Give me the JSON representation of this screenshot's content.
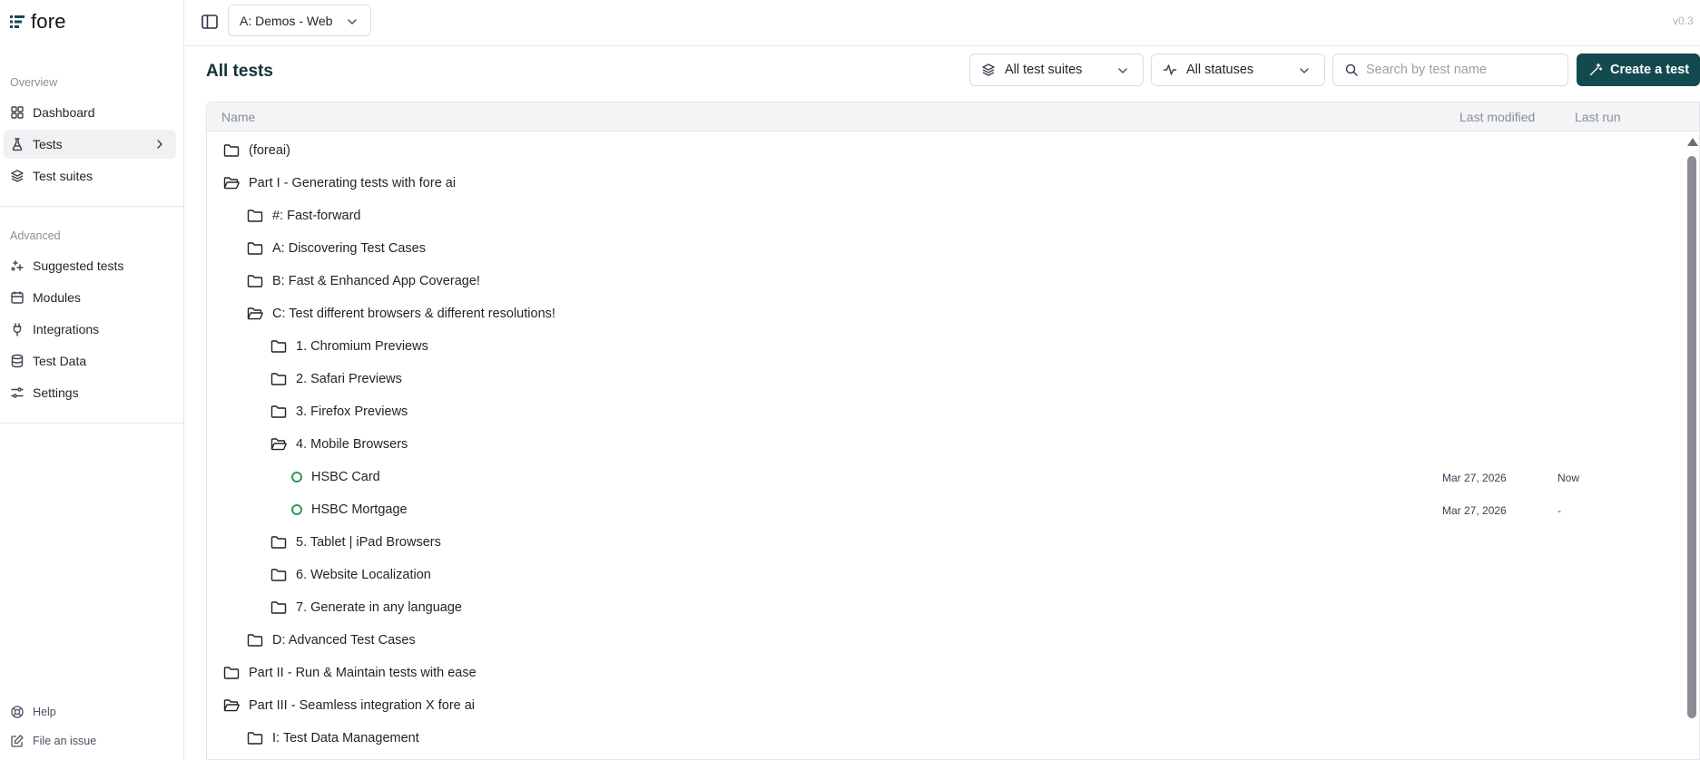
{
  "app": {
    "name": "fore",
    "version": "v0.3"
  },
  "topbar": {
    "project": "A: Demos - Web"
  },
  "sidebar": {
    "overview_label": "Overview",
    "overview_items": [
      {
        "label": "Dashboard",
        "icon": "dashboard-icon"
      },
      {
        "label": "Tests",
        "icon": "flask-icon",
        "active": true
      },
      {
        "label": "Test suites",
        "icon": "layers-icon"
      }
    ],
    "advanced_label": "Advanced",
    "advanced_items": [
      {
        "label": "Suggested tests",
        "icon": "sparkle-icon"
      },
      {
        "label": "Modules",
        "icon": "calendar-icon"
      },
      {
        "label": "Integrations",
        "icon": "plug-icon"
      },
      {
        "label": "Test Data",
        "icon": "database-icon"
      },
      {
        "label": "Settings",
        "icon": "sliders-icon"
      }
    ],
    "footer_items": [
      {
        "label": "Help",
        "icon": "help-icon"
      },
      {
        "label": "File an issue",
        "icon": "edit-icon"
      }
    ]
  },
  "main": {
    "title": "All tests",
    "filters": {
      "suites": "All test suites",
      "statuses": "All statuses"
    },
    "search_placeholder": "Search by test name",
    "create_label": "Create a test",
    "columns": {
      "name": "Name",
      "last_modified": "Last modified",
      "last_run": "Last run"
    },
    "rows": [
      {
        "name": "(foreai)",
        "depth": 0,
        "type": "folder",
        "open": false
      },
      {
        "name": "Part I - Generating tests with fore ai",
        "depth": 0,
        "type": "folder",
        "open": true
      },
      {
        "name": "#: Fast-forward",
        "depth": 1,
        "type": "folder",
        "open": false
      },
      {
        "name": "A: Discovering Test Cases",
        "depth": 1,
        "type": "folder",
        "open": false
      },
      {
        "name": "B: Fast & Enhanced App Coverage!",
        "depth": 1,
        "type": "folder",
        "open": false
      },
      {
        "name": "C: Test different browsers & different resolutions!",
        "depth": 1,
        "type": "folder",
        "open": true
      },
      {
        "name": "1. Chromium Previews",
        "depth": 2,
        "type": "folder",
        "open": false
      },
      {
        "name": "2. Safari Previews",
        "depth": 2,
        "type": "folder",
        "open": false
      },
      {
        "name": "3. Firefox Previews",
        "depth": 2,
        "type": "folder",
        "open": false
      },
      {
        "name": "4. Mobile Browsers",
        "depth": 2,
        "type": "folder",
        "open": true
      },
      {
        "name": "HSBC Card",
        "depth": 3,
        "type": "test",
        "last_modified": "Mar 27, 2026",
        "last_run": "Now"
      },
      {
        "name": "HSBC Mortgage",
        "depth": 3,
        "type": "test",
        "last_modified": "Mar 27, 2026",
        "last_run": "-"
      },
      {
        "name": "5. Tablet | iPad Browsers",
        "depth": 2,
        "type": "folder",
        "open": false
      },
      {
        "name": "6. Website Localization",
        "depth": 2,
        "type": "folder",
        "open": false
      },
      {
        "name": "7. Generate in any language",
        "depth": 2,
        "type": "folder",
        "open": false
      },
      {
        "name": "D: Advanced Test Cases",
        "depth": 1,
        "type": "folder",
        "open": false
      },
      {
        "name": "Part II - Run & Maintain tests with ease",
        "depth": 0,
        "type": "folder",
        "open": false
      },
      {
        "name": "Part III - Seamless integration X fore ai",
        "depth": 0,
        "type": "folder",
        "open": true
      },
      {
        "name": "I: Test Data Management",
        "depth": 1,
        "type": "folder",
        "open": false
      }
    ]
  },
  "colors": {
    "accent": "#134a4f",
    "status_ok": "#2e9b5a",
    "title": "#12313a"
  }
}
